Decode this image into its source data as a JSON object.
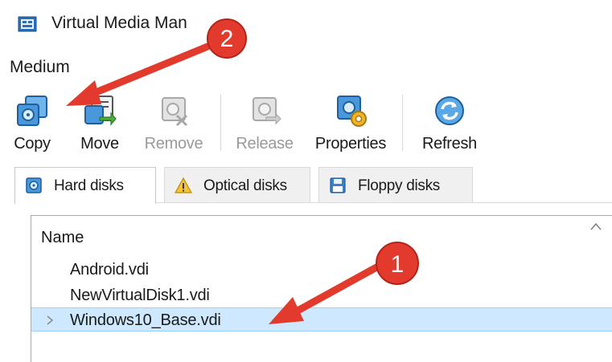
{
  "window": {
    "title": "Virtual Media Man",
    "icon": "virtualbox-media-icon"
  },
  "menubar": {
    "items": [
      "Medium"
    ]
  },
  "toolbar": {
    "buttons": [
      {
        "label": "Copy",
        "icon": "copy-disk-icon",
        "enabled": true
      },
      {
        "label": "Move",
        "icon": "move-disk-icon",
        "enabled": true
      },
      {
        "label": "Remove",
        "icon": "remove-disk-icon",
        "enabled": false
      },
      {
        "label": "Release",
        "icon": "release-disk-icon",
        "enabled": false
      },
      {
        "label": "Properties",
        "icon": "properties-icon",
        "enabled": true
      },
      {
        "label": "Refresh",
        "icon": "refresh-icon",
        "enabled": true
      }
    ]
  },
  "tabs": [
    {
      "label": "Hard disks",
      "icon": "hard-disk-icon",
      "active": true
    },
    {
      "label": "Optical disks",
      "icon": "warning-icon",
      "active": false
    },
    {
      "label": "Floppy disks",
      "icon": "floppy-disk-icon",
      "active": false
    }
  ],
  "list": {
    "column_header": "Name",
    "rows": [
      {
        "name": "Android.vdi",
        "selected": false,
        "expandable": false
      },
      {
        "name": "NewVirtualDisk1.vdi",
        "selected": false,
        "expandable": false
      },
      {
        "name": "Windows10_Base.vdi",
        "selected": true,
        "expandable": true
      }
    ]
  },
  "annotations": [
    {
      "number": "2",
      "points_to": "Copy"
    },
    {
      "number": "1",
      "points_to": "Windows10_Base.vdi"
    }
  ],
  "colors": {
    "annotation_red": "#e23b2e",
    "selection": "#cde8ff",
    "accent_blue": "#2a7fd4"
  }
}
